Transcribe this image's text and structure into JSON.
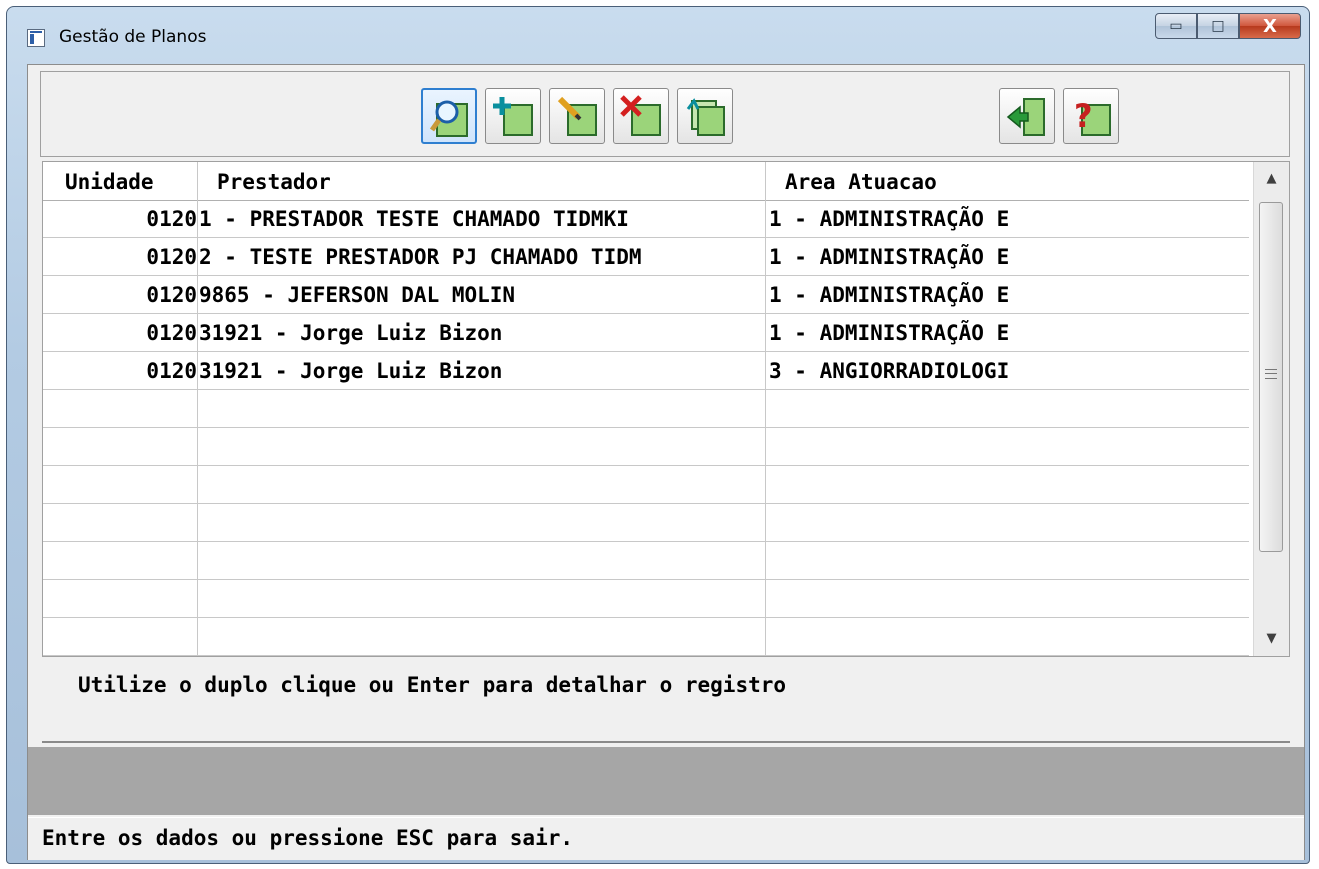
{
  "window": {
    "title": "Gestão de Planos",
    "controls": {
      "minimize": "▭",
      "maximize": "□",
      "close": "X"
    }
  },
  "toolbar": {
    "buttons": [
      {
        "name": "search-button",
        "icon": "magnifier-icon"
      },
      {
        "name": "add-button",
        "icon": "plus-icon"
      },
      {
        "name": "edit-button",
        "icon": "pencil-icon"
      },
      {
        "name": "delete-button",
        "icon": "x-icon"
      },
      {
        "name": "copy-button",
        "icon": "copy-icon"
      },
      {
        "name": "exit-button",
        "icon": "exit-door-icon"
      },
      {
        "name": "help-button",
        "icon": "question-icon"
      }
    ]
  },
  "grid": {
    "columns": [
      "Unidade",
      "Prestador",
      "Area Atuacao"
    ],
    "rows": [
      {
        "unidade": "0120",
        "prestador": "1 - PRESTADOR TESTE CHAMADO TIDMKI",
        "area": "1 - ADMINISTRAÇÃO E"
      },
      {
        "unidade": "0120",
        "prestador": "2 - TESTE PRESTADOR PJ CHAMADO TIDM",
        "area": "1 - ADMINISTRAÇÃO E"
      },
      {
        "unidade": "0120",
        "prestador": "9865 - JEFERSON DAL MOLIN",
        "area": "1 - ADMINISTRAÇÃO E"
      },
      {
        "unidade": "0120",
        "prestador": "31921 - Jorge Luiz Bizon",
        "area": "1 - ADMINISTRAÇÃO E"
      },
      {
        "unidade": "0120",
        "prestador": "31921 - Jorge Luiz Bizon",
        "area": "3 - ANGIORRADIOLOGI"
      },
      {
        "unidade": "",
        "prestador": "",
        "area": ""
      },
      {
        "unidade": "",
        "prestador": "",
        "area": ""
      },
      {
        "unidade": "",
        "prestador": "",
        "area": ""
      },
      {
        "unidade": "",
        "prestador": "",
        "area": ""
      },
      {
        "unidade": "",
        "prestador": "",
        "area": ""
      },
      {
        "unidade": "",
        "prestador": "",
        "area": ""
      },
      {
        "unidade": "",
        "prestador": "",
        "area": ""
      }
    ],
    "scrollbar": {
      "up": "▲",
      "down": "▼"
    }
  },
  "hint": "Utilize o duplo clique ou Enter para detalhar o registro",
  "status": "Entre os dados ou pressione ESC para sair.",
  "colors": {
    "accent": "#2f7fd0",
    "close": "#c8442a",
    "graybar": "#a6a6a6"
  }
}
